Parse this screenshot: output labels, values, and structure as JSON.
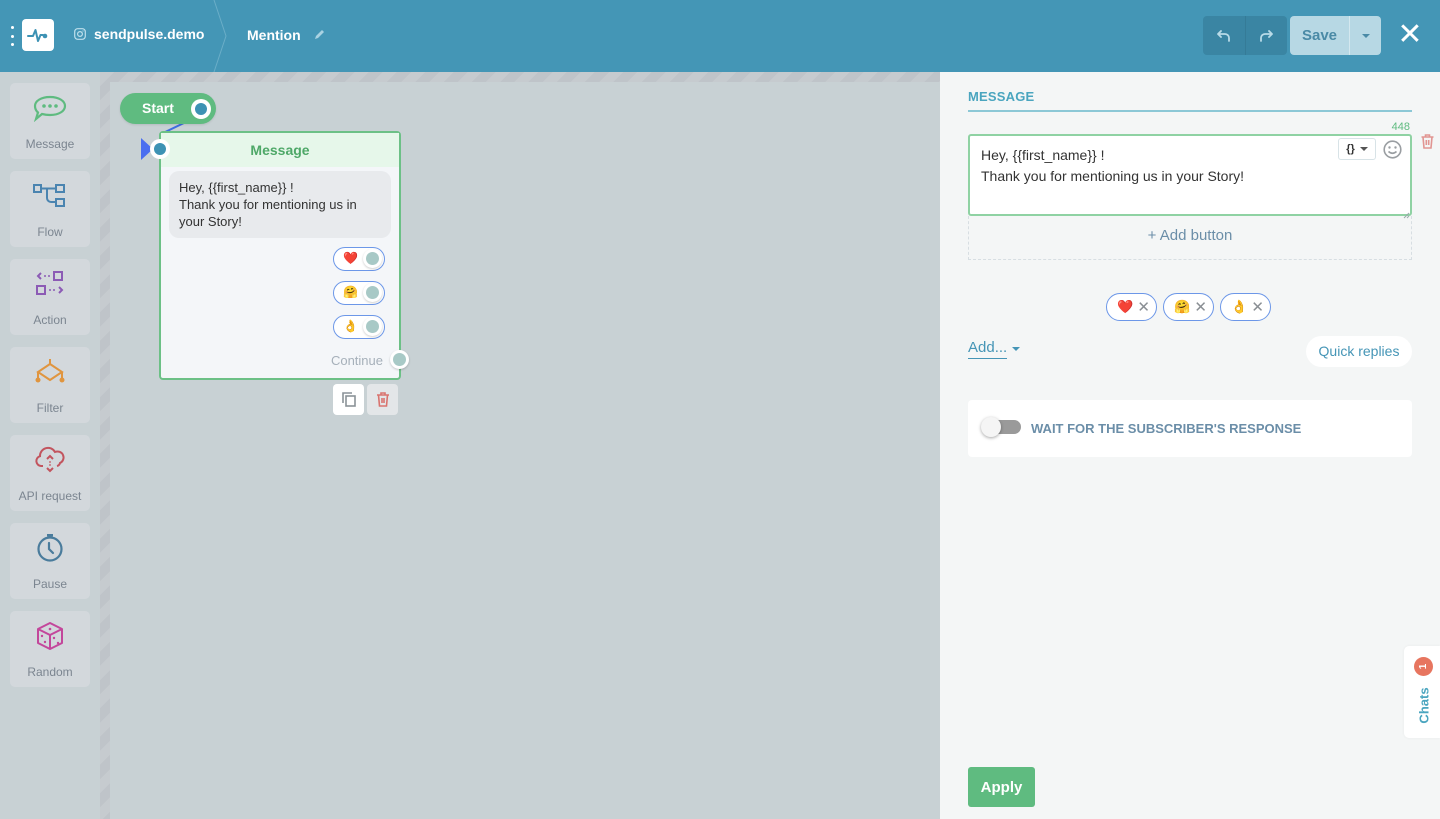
{
  "header": {
    "account_name": "sendpulse.demo",
    "account_icon": "instagram-icon",
    "flow_name": "Mention",
    "undo_label": "undo",
    "redo_label": "redo",
    "save_label": "Save",
    "close_label": "✕"
  },
  "sidebar": {
    "items": [
      {
        "label": "Message",
        "icon": "chat-bubble-icon",
        "color": "#5fbb80"
      },
      {
        "label": "Flow",
        "icon": "flow-icon",
        "color": "#4a84b0"
      },
      {
        "label": "Action",
        "icon": "action-icon",
        "color": "#8c5bb5"
      },
      {
        "label": "Filter",
        "icon": "filter-icon",
        "color": "#e0953f"
      },
      {
        "label": "API request",
        "icon": "cloud-api-icon",
        "color": "#c2545e"
      },
      {
        "label": "Pause",
        "icon": "stopwatch-icon",
        "color": "#4a7c9c"
      },
      {
        "label": "Random",
        "icon": "dice-icon",
        "color": "#c3479b"
      }
    ]
  },
  "canvas": {
    "start_node": {
      "label": "Start"
    },
    "message_node": {
      "title": "Message",
      "text": "Hey, {{first_name}} !\nThank you for mentioning us in your Story!",
      "quick_replies": [
        "❤️",
        "🤗",
        "👌"
      ],
      "continue_label": "Continue"
    }
  },
  "panel": {
    "title": "MESSAGE",
    "char_counter": "448",
    "message_text": "Hey, {{first_name}} !\nThank you for mentioning us in your Story!",
    "variables_button": "{}",
    "add_button_label": "+ Add button",
    "quick_replies": [
      "❤️",
      "🤗",
      "👌"
    ],
    "add_link": "Add...",
    "quick_replies_button": "Quick replies",
    "wait_toggle": {
      "label": "WAIT FOR THE SUBSCRIBER'S RESPONSE",
      "enabled": false
    },
    "apply_label": "Apply"
  },
  "chats_tab": {
    "label": "Chats",
    "badge": "1"
  },
  "colors": {
    "brand": "#4496b6",
    "accent_green": "#5fbb80",
    "danger": "#e7755f",
    "link": "#4595b6"
  }
}
